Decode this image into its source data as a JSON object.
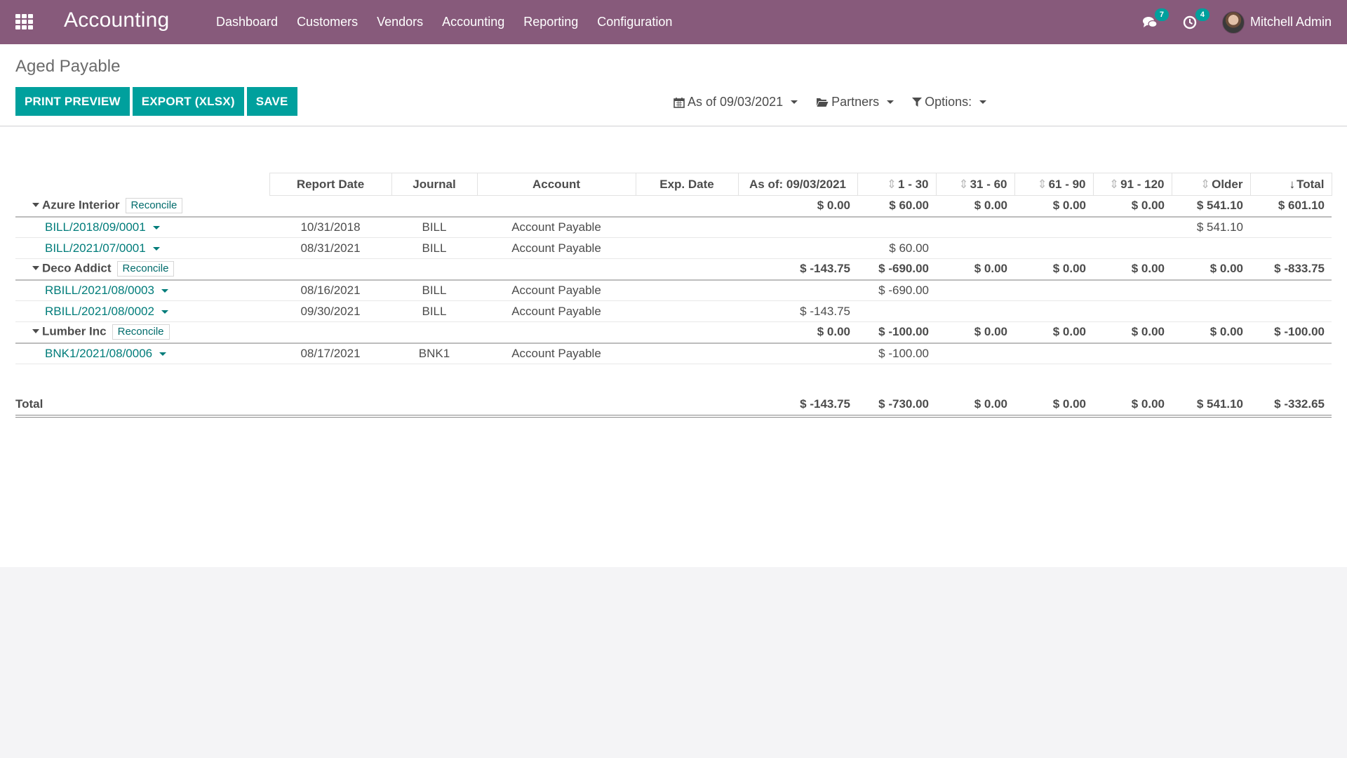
{
  "navbar": {
    "brand": "Accounting",
    "menu": [
      "Dashboard",
      "Customers",
      "Vendors",
      "Accounting",
      "Reporting",
      "Configuration"
    ],
    "messages_count": "7",
    "activities_count": "4",
    "user_name": "Mitchell Admin"
  },
  "control_panel": {
    "breadcrumb": "Aged Payable",
    "buttons": {
      "print_preview": "PRINT PREVIEW",
      "export": "EXPORT (XLSX)",
      "save": "SAVE"
    },
    "filters": {
      "date": "As of 09/03/2021",
      "partners": "Partners",
      "options": "Options:"
    }
  },
  "report": {
    "headers": {
      "report_date": "Report Date",
      "journal": "Journal",
      "account": "Account",
      "exp_date": "Exp. Date",
      "as_of": "As of: 09/03/2021",
      "p1_30": "1 - 30",
      "p31_60": "31 - 60",
      "p61_90": "61 - 90",
      "p91_120": "91 - 120",
      "older": "Older",
      "total": "Total"
    },
    "reconcile_label": "Reconcile",
    "groups": [
      {
        "name": "Azure Interior",
        "as_of": "$ 0.00",
        "p1_30": "$ 60.00",
        "p31_60": "$ 0.00",
        "p61_90": "$ 0.00",
        "p91_120": "$ 0.00",
        "older": "$ 541.10",
        "total": "$ 601.10",
        "lines": [
          {
            "doc": "BILL/2018/09/0001",
            "report_date": "10/31/2018",
            "journal": "BILL",
            "account": "Account Payable",
            "as_of": "",
            "p1_30": "",
            "older": "$ 541.10"
          },
          {
            "doc": "BILL/2021/07/0001",
            "report_date": "08/31/2021",
            "journal": "BILL",
            "account": "Account Payable",
            "as_of": "",
            "p1_30": "$ 60.00",
            "older": ""
          }
        ]
      },
      {
        "name": "Deco Addict",
        "as_of": "$ -143.75",
        "p1_30": "$ -690.00",
        "p31_60": "$ 0.00",
        "p61_90": "$ 0.00",
        "p91_120": "$ 0.00",
        "older": "$ 0.00",
        "total": "$ -833.75",
        "lines": [
          {
            "doc": "RBILL/2021/08/0003",
            "report_date": "08/16/2021",
            "journal": "BILL",
            "account": "Account Payable",
            "as_of": "",
            "p1_30": "$ -690.00",
            "older": ""
          },
          {
            "doc": "RBILL/2021/08/0002",
            "report_date": "09/30/2021",
            "journal": "BILL",
            "account": "Account Payable",
            "as_of": "$ -143.75",
            "p1_30": "",
            "older": ""
          }
        ]
      },
      {
        "name": "Lumber Inc",
        "as_of": "$ 0.00",
        "p1_30": "$ -100.00",
        "p31_60": "$ 0.00",
        "p61_90": "$ 0.00",
        "p91_120": "$ 0.00",
        "older": "$ 0.00",
        "total": "$ -100.00",
        "lines": [
          {
            "doc": "BNK1/2021/08/0006",
            "report_date": "08/17/2021",
            "journal": "BNK1",
            "account": "Account Payable",
            "as_of": "",
            "p1_30": "$ -100.00",
            "older": ""
          }
        ]
      }
    ],
    "total": {
      "label": "Total",
      "as_of": "$ -143.75",
      "p1_30": "$ -730.00",
      "p31_60": "$ 0.00",
      "p61_90": "$ 0.00",
      "p91_120": "$ 0.00",
      "older": "$ 541.10",
      "total": "$ -332.65"
    }
  }
}
